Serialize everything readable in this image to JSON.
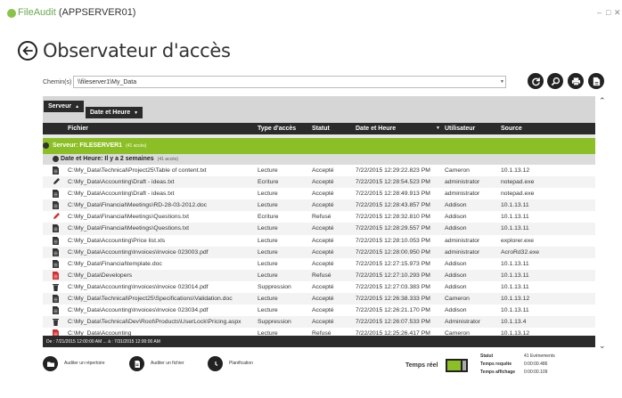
{
  "window": {
    "brand": "FileAudit",
    "server": "(APPSERVER01)",
    "controls": [
      "–",
      "□",
      "✕"
    ]
  },
  "page": {
    "title": "Observateur d'accès"
  },
  "path": {
    "label": "Chemin(s)",
    "value": "\\\\fileserver1\\My_Data"
  },
  "toolbar": {
    "icons": [
      "refresh-icon",
      "search-icon",
      "print-icon",
      "export-icon"
    ]
  },
  "grouping": {
    "chip1": "Serveur",
    "chip2": "Date et Heure"
  },
  "columns": {
    "file": "Fichier",
    "access_type": "Type d'accès",
    "status": "Statut",
    "datetime": "Date et Heure",
    "user": "Utilisateur",
    "source": "Source"
  },
  "groups": {
    "server": {
      "label": "Serveur: FILESERVER1",
      "count": "(41 accès)"
    },
    "date": {
      "label": "Date et Heure: Il y a 2 semaines",
      "count": "(41 accès)"
    }
  },
  "rows": [
    {
      "icon": "document",
      "file": "C:\\My_Data\\Technical\\Project25\\Table of content.txt",
      "type": "Lecture",
      "status": "Accepté",
      "datetime": "7/22/2015 12:29:22.823 PM",
      "user": "Cameron",
      "source": "10.1.13.12"
    },
    {
      "icon": "pencil",
      "file": "C:\\My_Data\\Accounting\\Draft - ideas.txt",
      "type": "Ecriture",
      "status": "Accepté",
      "datetime": "7/22/2015 12:28:54.523 PM",
      "user": "administrator",
      "source": "notepad.exe"
    },
    {
      "icon": "document",
      "file": "C:\\My_Data\\Accounting\\Draft - ideas.txt",
      "type": "Lecture",
      "status": "Accepté",
      "datetime": "7/22/2015 12:28:49.913 PM",
      "user": "administrator",
      "source": "notepad.exe"
    },
    {
      "icon": "document",
      "file": "C:\\My_Data\\Financial\\Meetings\\RD-28-03-2012.doc",
      "type": "Lecture",
      "status": "Accepté",
      "datetime": "7/22/2015 12:28:43.857 PM",
      "user": "Addison",
      "source": "10.1.13.11"
    },
    {
      "icon": "pencil-red",
      "file": "C:\\My_Data\\Financial\\Meetings\\Questions.txt",
      "type": "Ecriture",
      "status": "Refusé",
      "datetime": "7/22/2015 12:28:32.810 PM",
      "user": "Addison",
      "source": "10.1.13.11"
    },
    {
      "icon": "document",
      "file": "C:\\My_Data\\Financial\\Meetings\\Questions.txt",
      "type": "Lecture",
      "status": "Accepté",
      "datetime": "7/22/2015 12:28:29.557 PM",
      "user": "Addison",
      "source": "10.1.13.11"
    },
    {
      "icon": "document",
      "file": "C:\\My_Data\\Accounting\\Price list.xls",
      "type": "Lecture",
      "status": "Accepté",
      "datetime": "7/22/2015 12:28:10.053 PM",
      "user": "administrator",
      "source": "explorer.exe"
    },
    {
      "icon": "document",
      "file": "C:\\My_Data\\Accounting\\Invoices\\Invoice 023003.pdf",
      "type": "Lecture",
      "status": "Accepté",
      "datetime": "7/22/2015 12:28:00.950 PM",
      "user": "administrator",
      "source": "AcroRd32.exe"
    },
    {
      "icon": "document",
      "file": "C:\\My_Data\\Financial\\template.doc",
      "type": "Lecture",
      "status": "Accepté",
      "datetime": "7/22/2015 12:27:15.973 PM",
      "user": "Addison",
      "source": "10.1.13.11"
    },
    {
      "icon": "document-red",
      "file": "C:\\My_Data\\Developers",
      "type": "Lecture",
      "status": "Refusé",
      "datetime": "7/22/2015 12:27:10.293 PM",
      "user": "Addison",
      "source": "10.1.13.11"
    },
    {
      "icon": "trash",
      "file": "C:\\My_Data\\Accounting\\Invoices\\Invoice 023014.pdf",
      "type": "Suppression",
      "status": "Accepté",
      "datetime": "7/22/2015 12:27:03.383 PM",
      "user": "Addison",
      "source": "10.1.13.11"
    },
    {
      "icon": "document",
      "file": "C:\\My_Data\\Technical\\Project25\\Specifications\\Validation.doc",
      "type": "Lecture",
      "status": "Accepté",
      "datetime": "7/22/2015 12:26:38.333 PM",
      "user": "Cameron",
      "source": "10.1.13.12"
    },
    {
      "icon": "document",
      "file": "C:\\My_Data\\Accounting\\Invoices\\Invoice 023034.pdf",
      "type": "Lecture",
      "status": "Accepté",
      "datetime": "7/22/2015 12:26:21.170 PM",
      "user": "Addison",
      "source": "10.1.13.11"
    },
    {
      "icon": "trash",
      "file": "C:\\My_Data\\Technical\\Dev\\Root\\Products\\UserLock\\Pricing.aspx",
      "type": "Suppression",
      "status": "Accepté",
      "datetime": "7/22/2015 12:26:07.533 PM",
      "user": "Administrator",
      "source": "10.1.13.4"
    },
    {
      "icon": "document-red",
      "file": "C:\\My_Data\\Accounting",
      "type": "Lecture",
      "status": "Refusé",
      "datetime": "7/22/2015 12:25:26.417 PM",
      "user": "Cameron",
      "source": "10.1.13.12"
    }
  ],
  "footer": {
    "range": "De : 7/21/2015 12:00:00 AM ... à : 7/31/2015 12:00:00 AM"
  },
  "actions": {
    "audit_folder": "Auditer un répertoire",
    "audit_file": "Auditer un fichier",
    "schedule": "Planification"
  },
  "realtime": {
    "label": "Temps réel",
    "on": true
  },
  "stats": {
    "status_k": "Statut",
    "status_v": "41 Evénements",
    "query_k": "Temps requête",
    "query_v": "0:00:00.486",
    "display_k": "Temps affichage",
    "display_v": "0:00:00.109"
  },
  "colors": {
    "accent": "#8cbf25",
    "dark": "#2b2b2b",
    "denied": "#d32f2f"
  }
}
